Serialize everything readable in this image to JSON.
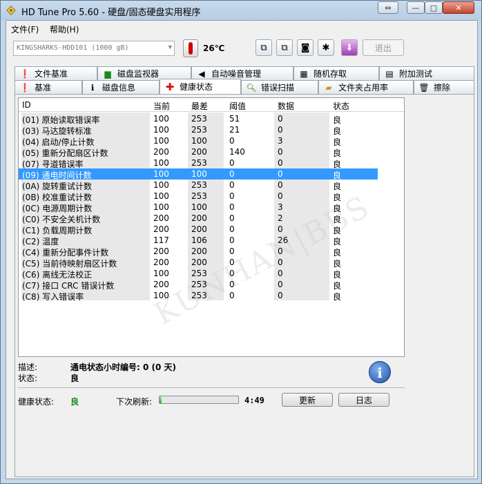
{
  "window": {
    "title": "HD Tune Pro 5.60 - 硬盘/固态硬盘实用程序",
    "controls": {
      "swap": "⇔",
      "minimize": "—",
      "maximize": "□",
      "close": "✕"
    }
  },
  "menu": {
    "file": "文件(F)",
    "help": "帮助(H)"
  },
  "toolbar": {
    "drive": "KINGSHARKS-HDD101 (1000 gB)",
    "temperature": "26℃",
    "exit_label": "退出"
  },
  "tabs_row1": [
    {
      "label": "文件基准",
      "icon": "file-benchmark-icon"
    },
    {
      "label": "磁盘监视器",
      "icon": "disk-monitor-icon"
    },
    {
      "label": "自动噪音管理",
      "icon": "speaker-icon"
    },
    {
      "label": "随机存取",
      "icon": "random-access-icon"
    },
    {
      "label": "附加测试",
      "icon": "extra-tests-icon"
    }
  ],
  "tabs_row2": [
    {
      "label": "基准",
      "icon": "benchmark-icon"
    },
    {
      "label": "磁盘信息",
      "icon": "info-icon"
    },
    {
      "label": "健康状态",
      "icon": "health-cross-icon",
      "active": true
    },
    {
      "label": "错误扫描",
      "icon": "magnifier-icon"
    },
    {
      "label": "文件夹占用率",
      "icon": "folder-icon"
    },
    {
      "label": "擦除",
      "icon": "trash-icon"
    }
  ],
  "table": {
    "headers": [
      "ID",
      "当前",
      "最差",
      "阈值",
      "数据",
      "状态"
    ],
    "selected_index": 5,
    "rows": [
      [
        "(01) 原始读取错误率",
        "100",
        "253",
        "51",
        "0",
        "良"
      ],
      [
        "(03) 马达旋转标准",
        "100",
        "253",
        "21",
        "0",
        "良"
      ],
      [
        "(04) 启动/停止计数",
        "100",
        "100",
        "0",
        "3",
        "良"
      ],
      [
        "(05) 重新分配扇区计数",
        "200",
        "200",
        "140",
        "0",
        "良"
      ],
      [
        "(07) 寻道错误率",
        "100",
        "253",
        "0",
        "0",
        "良"
      ],
      [
        "(09) 通电时间计数",
        "100",
        "100",
        "0",
        "0",
        "良"
      ],
      [
        "(0A) 旋转重试计数",
        "100",
        "253",
        "0",
        "0",
        "良"
      ],
      [
        "(0B) 校准重试计数",
        "100",
        "253",
        "0",
        "0",
        "良"
      ],
      [
        "(0C) 电源周期计数",
        "100",
        "100",
        "0",
        "3",
        "良"
      ],
      [
        "(C0) 不安全关机计数",
        "200",
        "200",
        "0",
        "2",
        "良"
      ],
      [
        "(C1) 负载周期计数",
        "200",
        "200",
        "0",
        "0",
        "良"
      ],
      [
        "(C2) 温度",
        "117",
        "106",
        "0",
        "26",
        "良"
      ],
      [
        "(C4) 重新分配事件计数",
        "200",
        "200",
        "0",
        "0",
        "良"
      ],
      [
        "(C5) 当前待映射扇区计数",
        "200",
        "200",
        "0",
        "0",
        "良"
      ],
      [
        "(C6) 离线无法校正",
        "100",
        "253",
        "0",
        "0",
        "良"
      ],
      [
        "(C7) 接口 CRC 错误计数",
        "200",
        "253",
        "0",
        "0",
        "良"
      ],
      [
        "(C8) 写入错误率",
        "100",
        "253",
        "0",
        "0",
        "良"
      ]
    ],
    "watermark": "KUNHAN|BBS"
  },
  "details": {
    "desc_label": "描述:",
    "desc_value": "通电状态小时编号: 0 (0 天)",
    "status_label": "状态:",
    "status_value": "良"
  },
  "footer": {
    "health_label": "健康状态:",
    "health_value": "良",
    "refresh_label": "下次刷新:",
    "refresh_progress": 0.03,
    "refresh_time": "4:49",
    "refresh_button": "更新",
    "log_button": "日志"
  },
  "colors": {
    "selection": "#3399ff",
    "health_good": "#1a8a1a"
  }
}
